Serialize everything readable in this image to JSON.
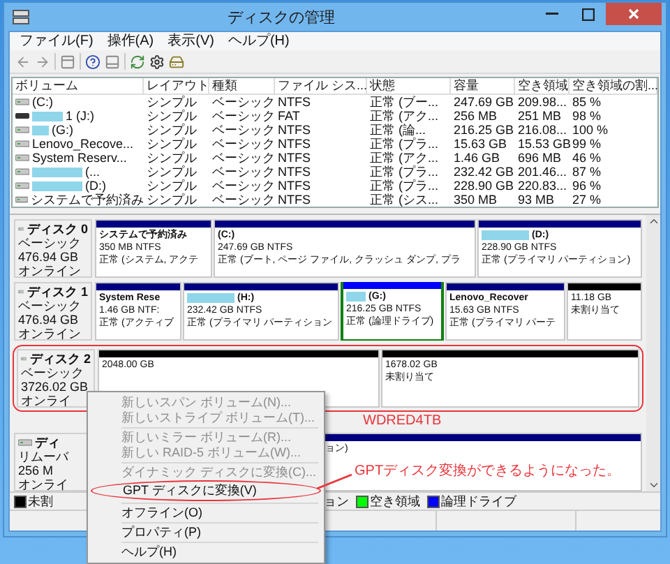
{
  "window": {
    "title": "ディスクの管理"
  },
  "menu_bar": [
    "ファイル(F)",
    "操作(A)",
    "表示(V)",
    "ヘルプ(H)"
  ],
  "volume_table": {
    "columns": [
      "ボリューム",
      "レイアウト",
      "種類",
      "ファイル シス...",
      "状態",
      "容量",
      "空き領域",
      "空き領域の割..."
    ],
    "rows": [
      {
        "kind": "fixed",
        "redacted": false,
        "cells": [
          "(C:)",
          "シンプル",
          "ベーシック",
          "NTFS",
          "正常 (ブー...",
          "247.69 GB",
          "209.98...",
          "85 %"
        ]
      },
      {
        "kind": "removable",
        "redacted": true,
        "cells": [
          "1 (J:)",
          "シンプル",
          "ベーシック",
          "FAT",
          "正常 (アク...",
          "256 MB",
          "251 MB",
          "98 %"
        ]
      },
      {
        "kind": "fixed",
        "redacted": true,
        "cells": [
          "(G:)",
          "シンプル",
          "ベーシック",
          "NTFS",
          "正常 (論...",
          "216.25 GB",
          "216.08...",
          "100 %"
        ]
      },
      {
        "kind": "fixed",
        "redacted": false,
        "cells": [
          "Lenovo_Recove...",
          "シンプル",
          "ベーシック",
          "NTFS",
          "正常 (プラ...",
          "15.63 GB",
          "15.53 GB",
          "99 %"
        ]
      },
      {
        "kind": "fixed",
        "redacted": false,
        "cells": [
          "System Reserv...",
          "シンプル",
          "ベーシック",
          "NTFS",
          "正常 (アク...",
          "1.46 GB",
          "696 MB",
          "46 %"
        ]
      },
      {
        "kind": "fixed",
        "redacted": true,
        "cells": [
          "(...",
          "シンプル",
          "ベーシック",
          "NTFS",
          "正常 (プラ...",
          "232.42 GB",
          "201.46...",
          "87 %"
        ]
      },
      {
        "kind": "fixed",
        "redacted": true,
        "cells": [
          "(D:)",
          "シンプル",
          "ベーシック",
          "NTFS",
          "正常 (プラ...",
          "228.90 GB",
          "220.83...",
          "96 %"
        ]
      },
      {
        "kind": "fixed",
        "redacted": false,
        "cells": [
          "システムで予約済み",
          "シンプル",
          "ベーシック",
          "NTFS",
          "正常 (シス...",
          "350 MB",
          "93 MB",
          "27 %"
        ]
      }
    ]
  },
  "disks": [
    {
      "name": "ディスク 0",
      "type": "ベーシック",
      "size": "476.94 GB",
      "status": "オンライン",
      "annotated": false,
      "partitions": [
        {
          "kind": "primary",
          "selected": false,
          "redacted": false,
          "name": "システムで予約済み",
          "size": "350 MB NTFS",
          "status": "正常 (システム, アクテ"
        },
        {
          "kind": "primary",
          "selected": false,
          "redacted": false,
          "name": "(C:)",
          "size": "247.69 GB NTFS",
          "status": "正常 (ブート, ページ ファイル, クラッシュ ダンプ, プラ"
        },
        {
          "kind": "primary",
          "selected": false,
          "redacted": true,
          "name": "(D:)",
          "size": "228.90 GB NTFS",
          "status": "正常 (プライマリ パーティション)"
        }
      ]
    },
    {
      "name": "ディスク 1",
      "type": "ベーシック",
      "size": "476.94 GB",
      "status": "オンライン",
      "annotated": false,
      "partitions": [
        {
          "kind": "primary",
          "selected": false,
          "redacted": false,
          "name": "System Rese",
          "size": "1.46 GB NTF:",
          "status": "正常 (アクティブ"
        },
        {
          "kind": "primary",
          "selected": false,
          "redacted": true,
          "name": "(H:)",
          "size": "232.42 GB NTFS",
          "status": "正常 (プライマリ パーティション"
        },
        {
          "kind": "logical",
          "selected": true,
          "redacted": true,
          "name": "(G:)",
          "size": "216.25 GB NTFS",
          "status": "正常 (論理ドライブ)"
        },
        {
          "kind": "primary",
          "selected": false,
          "redacted": false,
          "name": "Lenovo_Recover",
          "size": "15.63 GB NTFS",
          "status": "正常 (プライマリ パーテ"
        },
        {
          "kind": "unallocated",
          "selected": false,
          "redacted": false,
          "size": "11.18 GB",
          "status": "未割り当て"
        }
      ]
    },
    {
      "name": "ディスク 2",
      "type": "ベーシック",
      "size": "3726.02 GB",
      "status": "オンライ",
      "annotated": true,
      "partitions": [
        {
          "kind": "unallocated",
          "selected": false,
          "redacted": false,
          "size": "2048.00 GB"
        },
        {
          "kind": "unallocated",
          "selected": false,
          "redacted": false,
          "size": "1678.02 GB",
          "status": "未割り当て"
        }
      ]
    },
    {
      "name": "ディ",
      "type": "リムーバ",
      "size": "256 M",
      "status": "オンライ",
      "annotated": false,
      "partitions": [
        {
          "kind": "primary",
          "selected": false,
          "redacted": false,
          "status": "ョン)"
        }
      ]
    }
  ],
  "legend": [
    {
      "label": "未割",
      "color": "#000000"
    },
    {
      "label": "ョン"
    },
    {
      "label": "空き領域",
      "color": "#00ff00"
    },
    {
      "label": "論理ドライブ",
      "color": "#0000ff"
    }
  ],
  "context_menu": [
    [
      {
        "label": "新しいスパン ボリューム(N)...",
        "disabled": true,
        "circled": false
      },
      {
        "label": "新しいストライプ ボリューム(T)...",
        "disabled": true,
        "circled": false
      }
    ],
    [
      {
        "label": "新しいミラー ボリューム(R)...",
        "disabled": true,
        "circled": false
      },
      {
        "label": "新しい RAID-5 ボリューム(W)...",
        "disabled": true,
        "circled": false
      }
    ],
    [
      {
        "label": "ダイナミック ディスクに変換(C)...",
        "disabled": true,
        "circled": false
      },
      {
        "label": "GPT ディスクに変換(V)",
        "disabled": false,
        "circled": true
      }
    ],
    [
      {
        "label": "オフライン(O)",
        "disabled": false,
        "circled": false
      }
    ],
    [
      {
        "label": "プロパティ(P)",
        "disabled": false,
        "circled": false
      }
    ],
    [
      {
        "label": "ヘルプ(H)",
        "disabled": false,
        "circled": false
      }
    ]
  ],
  "annotations": {
    "disk_label": "WDRED4TB",
    "note": "GPTディスク変換ができるようになった。"
  }
}
